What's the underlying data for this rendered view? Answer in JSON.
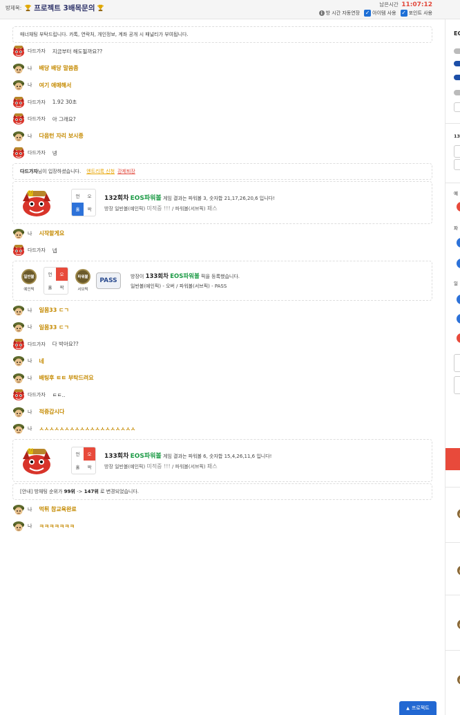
{
  "header": {
    "room_label": "방제목:",
    "room_name": "프로젝트 3배목문의",
    "remain_label": "남은시간",
    "remain_time": "11:07:12",
    "auto_extend": "방 시간 자동연장",
    "use_item": "아이템 사용",
    "use_point": "포인트 사용"
  },
  "notice": "매너채팅 부탁드립니다. 카톡, 연락처, 개인정보, 계좌 공개 시 패널티가 부여됩니다.",
  "msgs_a": [
    {
      "who": "other",
      "nick": "다드가자",
      "text": "지금부터 해도될까요??"
    },
    {
      "who": "me",
      "nick": "나",
      "text": "배당 배당 말씀좀"
    },
    {
      "who": "me",
      "nick": "나",
      "text": "여기 애매해서"
    },
    {
      "who": "other",
      "nick": "다드가자",
      "text": "1.92 30초"
    },
    {
      "who": "other",
      "nick": "다드가자",
      "text": "아 그래요?"
    },
    {
      "who": "me",
      "nick": "나",
      "text": "다음턴 자리 보시죵"
    },
    {
      "who": "other",
      "nick": "다드가자",
      "text": "넹"
    }
  ],
  "enter": {
    "name": "다드가자",
    "suffix": "님이 입장하셨습니다.",
    "link1": "엔트리록 신청",
    "link2": "강제퇴장"
  },
  "result1": {
    "round": "132회차",
    "game": "EOS파워볼",
    "desc": "게임 결과는 파워볼 3, 숫자합 21,17,26,20,6 입니다!",
    "line2_pre": "방장 일반볼(예인픽)",
    "line2_mid": "미적중 !!!",
    "line2_post": "/ 파워볼(서브픽)",
    "line2_end": "패스",
    "cells": [
      "언",
      "오",
      "홀",
      "짝"
    ]
  },
  "msgs_b": [
    {
      "who": "me",
      "nick": "나",
      "text": "시작할게요"
    },
    {
      "who": "other",
      "nick": "다드가자",
      "text": "넵"
    }
  ],
  "bet": {
    "badge1": "일반볼",
    "badge1_cap": "예인픽",
    "badge2": "파워볼",
    "badge2_cap": "서브픽",
    "pass": "PASS",
    "cells": [
      "언",
      "오",
      "홀",
      "짝"
    ],
    "pre": "방장이",
    "round": "133회차",
    "game": "EOS파워볼",
    "post": "픽을 등록했습니다.",
    "line2": "일반볼(예인픽) - 오버 / 파워볼(서브픽) - PASS"
  },
  "msgs_c": [
    {
      "who": "me",
      "nick": "나",
      "text": "일몸33 ㄷㄱ"
    },
    {
      "who": "me",
      "nick": "나",
      "text": "일몸33 ㄷㄱ"
    },
    {
      "who": "other",
      "nick": "다드가자",
      "text": "다 박아요??"
    },
    {
      "who": "me",
      "nick": "나",
      "text": "네"
    },
    {
      "who": "me",
      "nick": "나",
      "text": "배팅후 ㅌㅌ 부탁드려요"
    },
    {
      "who": "other",
      "nick": "다드가자",
      "text": "ㅌㅌ.."
    },
    {
      "who": "me",
      "nick": "나",
      "text": "적중갑시다"
    },
    {
      "who": "me",
      "nick": "나",
      "text": "ㅅㅅㅅㅅㅅㅅㅅㅅㅅㅅㅅㅅㅅㅅㅅㅅㅅㅅㅅ"
    }
  ],
  "result2": {
    "round": "133회차",
    "game": "EOS파워볼",
    "desc": "게임 결과는 파워볼 6, 숫자합 15,4,26,11,6 입니다!",
    "line2_pre": "방장 일반볼(예인픽)",
    "line2_mid": "미적중 !!!",
    "line2_post": "/ 파워볼(서브픽)",
    "line2_end": "패스",
    "cells": [
      "언",
      "오",
      "홀",
      "짝"
    ]
  },
  "rank_notice": {
    "pre": "[안내] 방채팅 순위가",
    "from": "99위",
    "arrow": "->",
    "to": "147위",
    "post": "로 변경되었습니다."
  },
  "msgs_d": [
    {
      "who": "me",
      "nick": "나",
      "text": "먹튀 참교육완료"
    },
    {
      "who": "me",
      "nick": "나",
      "text": "ㅋㅋㅋㅋㅋㅋㅋ"
    }
  ],
  "right_panel": {
    "title": "EC",
    "label_133": "13",
    "label_a": "예",
    "label_b": "파",
    "label_c": "일"
  },
  "float_button": "프로젝트",
  "colors": {
    "accent_blue": "#2268d2",
    "my_msg": "#c58a00",
    "time_red": "#e2473a",
    "eos_green": "#1a9a44"
  }
}
